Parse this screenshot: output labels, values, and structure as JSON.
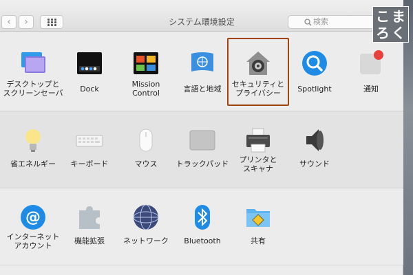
{
  "window": {
    "title": "システム環境設定"
  },
  "toolbar": {
    "back_glyph": "‹",
    "forward_glyph": "›",
    "search_placeholder": "検索"
  },
  "corner_logo": {
    "chars": [
      "こ",
      "ま",
      "ろ",
      "く"
    ]
  },
  "sections": {
    "personal": [
      {
        "id": "desktop",
        "label": "デスクトップと\nスクリーンセーバ",
        "icon": "desktop-screensaver-icon"
      },
      {
        "id": "dock",
        "label": "Dock",
        "icon": "dock-icon"
      },
      {
        "id": "mission",
        "label": "Mission\nControl",
        "icon": "mission-control-icon"
      },
      {
        "id": "language",
        "label": "言語と地域",
        "icon": "un-flag-icon"
      },
      {
        "id": "security",
        "label": "セキュリティと\nプライバシー",
        "icon": "security-house-icon"
      },
      {
        "id": "spotlight",
        "label": "Spotlight",
        "icon": "magnifier-icon"
      },
      {
        "id": "notifications",
        "label": "通知",
        "icon": "notifications-icon"
      }
    ],
    "hardware": [
      {
        "id": "energy",
        "label": "省エネルギー",
        "icon": "lightbulb-icon"
      },
      {
        "id": "keyboard",
        "label": "キーボード",
        "icon": "keyboard-icon"
      },
      {
        "id": "mouse",
        "label": "マウス",
        "icon": "mouse-icon"
      },
      {
        "id": "trackpad",
        "label": "トラックパッド",
        "icon": "trackpad-icon"
      },
      {
        "id": "printers",
        "label": "プリンタと\nスキャナ",
        "icon": "printer-icon"
      },
      {
        "id": "sound",
        "label": "サウンド",
        "icon": "speaker-icon"
      }
    ],
    "internet": [
      {
        "id": "accounts",
        "label": "インターネット\nアカウント",
        "icon": "at-sign-icon"
      },
      {
        "id": "extensions",
        "label": "機能拡張",
        "icon": "puzzle-piece-icon"
      },
      {
        "id": "network",
        "label": "ネットワーク",
        "icon": "network-globe-icon"
      },
      {
        "id": "bluetooth",
        "label": "Bluetooth",
        "icon": "bluetooth-icon"
      },
      {
        "id": "sharing",
        "label": "共有",
        "icon": "sharing-folder-icon"
      }
    ]
  },
  "colors": {
    "highlight": "#a04512",
    "accent_blue": "#1e8ce6",
    "badge_red": "#e8403a"
  }
}
